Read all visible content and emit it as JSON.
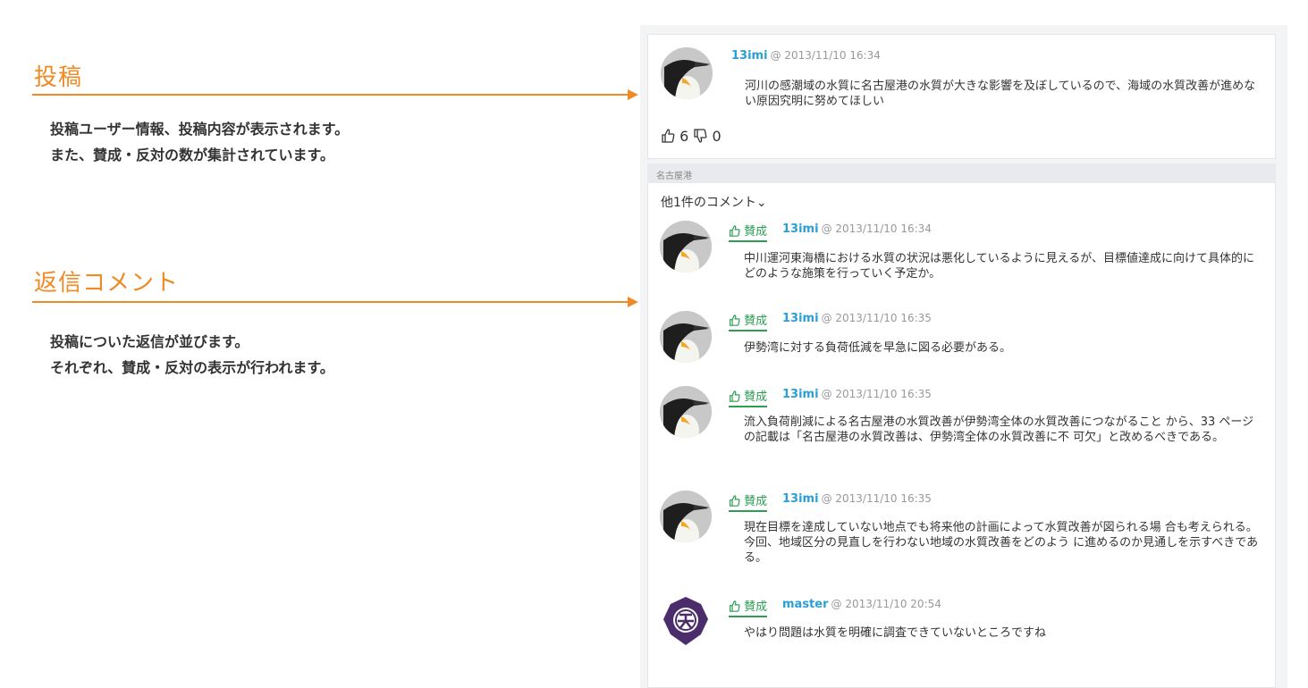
{
  "annotations": {
    "post": {
      "title": "投稿",
      "desc1": "投稿ユーザー情報、投稿内容が表示されます。",
      "desc2": "また、賛成・反対の数が集計されています。"
    },
    "reply": {
      "title": "返信コメント",
      "desc1": "投稿についた返信が並びます。",
      "desc2": "それぞれ、賛成・反対の表示が行われます。"
    }
  },
  "post": {
    "user": "13imi",
    "timestamp": "@ 2013/11/10 16:34",
    "body": "河川の感潮域の水質に名古屋港の水質が大きな影響を及ぼしているので、海域の水質改善が進めない原因究明に努めてほしい",
    "likes": "6",
    "dislikes": "0"
  },
  "section_label": "名古屋港",
  "more_comments": "他1件のコメント⌄",
  "colors": {
    "accent": "#f08a24",
    "user": "#2a9fd6",
    "agree": "#2e9e55"
  },
  "comments": [
    {
      "vote": "賛成",
      "user": "13imi",
      "timestamp": "@ 2013/11/10 16:34",
      "body": "中川運河東海橋における水質の状況は悪化しているように見えるが、目標値達成に向けて具体的にどのような施策を行っていく予定か。"
    },
    {
      "vote": "賛成",
      "user": "13imi",
      "timestamp": "@ 2013/11/10 16:35",
      "body": "伊勢湾に対する負荷低減を早急に図る必要がある。"
    },
    {
      "vote": "賛成",
      "user": "13imi",
      "timestamp": "@ 2013/11/10 16:35",
      "body": "流入負荷削減による名古屋港の水質改善が伊勢湾全体の水質改善につながること から、33 ページの記載は「名古屋港の水質改善は、伊勢湾全体の水質改善に不 可欠」と改めるべきである。"
    },
    {
      "vote": "賛成",
      "user": "13imi",
      "timestamp": "@ 2013/11/10 16:35",
      "body": "現在目標を達成していない地点でも将来他の計画によって水質改善が図られる場 合も考えられる。今回、地域区分の見直しを行わない地域の水質改善をどのよう に進めるのか見通しを示すべきである。"
    },
    {
      "vote": "賛成",
      "user": "master",
      "timestamp": "@ 2013/11/10 20:54",
      "body": "やはり問題は水質を明確に調査できていないところですね"
    }
  ]
}
